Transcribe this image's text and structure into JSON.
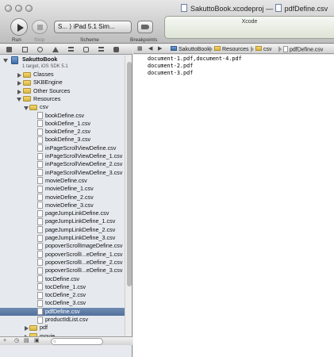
{
  "window": {
    "title_project": "SakuttoBook.xcodeproj",
    "title_separator": "—",
    "title_file": "pdfDefine.csv"
  },
  "toolbar": {
    "run_label": "Run",
    "stop_label": "Stop",
    "scheme_value": "S... ⟩ iPad 5.1 Sim...",
    "scheme_label": "Scheme",
    "breakpoints_label": "Breakpoints",
    "activity_text": "Xcode"
  },
  "navigator": {
    "project": {
      "name": "SakuttoBook",
      "subtitle": "1 target, iOS SDK 5.1"
    },
    "groups": {
      "classes": "Classes",
      "skbengine": "SKBEngine",
      "other_sources": "Other Sources",
      "resources": "Resources",
      "csv": "csv",
      "pdf": "pdf",
      "movie": "movie"
    },
    "files": [
      "bookDefine.csv",
      "bookDefine_1.csv",
      "bookDefine_2.csv",
      "bookDefine_3.csv",
      "inPageScrollViewDefine.csv",
      "inPageScrollViewDefine_1.csv",
      "inPageScrollViewDefine_2.csv",
      "inPageScrollViewDefine_3.csv",
      "movieDefine.csv",
      "movieDefine_1.csv",
      "movieDefine_2.csv",
      "movieDefine_3.csv",
      "pageJumpLinkDefine.csv",
      "pageJumpLinkDefine_1.csv",
      "pageJumpLinkDefine_2.csv",
      "pageJumpLinkDefine_3.csv",
      "popoverScrollImageDefine.csv",
      "popoverScrollI...eDefine_1.csv",
      "popoverScrollI...eDefine_2.csv",
      "popoverScrollI...eDefine_3.csv",
      "tocDefine.csv",
      "tocDefine_1.csv",
      "tocDefine_2.csv",
      "tocDefine_3.csv",
      "pdfDefine.csv",
      "productIdList.csv"
    ],
    "selected_file": "pdfDefine.csv"
  },
  "jumpbar": {
    "project": "SakuttoBook",
    "resources": "Resources",
    "csv": "csv",
    "file": "pdfDefine.csv"
  },
  "editor": {
    "lines": [
      "document-1.pdf,document-4.pdf",
      "document-2.pdf",
      "document-3.pdf"
    ]
  },
  "colors": {
    "selection": "#5d7aa6",
    "folder": "#e8c65a",
    "navigator_bg": "#e6eaef"
  }
}
